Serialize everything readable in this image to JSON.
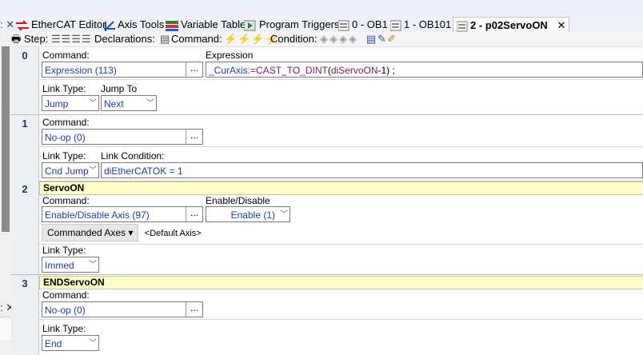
{
  "tabs": [
    {
      "label": "EtherCAT Editor",
      "icon": "ethercat-icon"
    },
    {
      "label": "Axis Tools",
      "icon": "axis-tools-icon"
    },
    {
      "label": "Variable Table",
      "icon": "variable-table-icon"
    },
    {
      "label": "Program Triggers",
      "icon": "program-triggers-icon"
    },
    {
      "label": "0 - OB1",
      "icon": "program-block-icon"
    },
    {
      "label": "1 - OB101",
      "icon": "program-block-icon"
    },
    {
      "label": "2 - p02ServoON",
      "icon": "program-block-icon"
    }
  ],
  "tab_close": "✕",
  "toolbar": {
    "step_label": "Step:",
    "declarations_label": "Declarations:",
    "command_label": "Command:",
    "condition_label": "Condition:"
  },
  "labels": {
    "command": "Command:",
    "expression": "Expression",
    "link_type": "Link Type:",
    "jump_to": "Jump To",
    "link_condition": "Link Condition:",
    "enable_disable": "Enable/Disable",
    "dots": "..."
  },
  "steps": [
    {
      "number": "0",
      "command_value": "Expression (113)",
      "expression_parts": {
        "var1": "_CurAxis",
        "op1": ":=",
        "fn": "CAST_TO_DINT",
        "p1": "(",
        "var2": "diServoON",
        "rest": "-1) ;"
      },
      "link_type": "Jump",
      "jump_to": "Next"
    },
    {
      "number": "1",
      "command_value": "No-op (0)",
      "link_type": "Cnd Jump",
      "link_condition": "diEtherCATOK = 1"
    },
    {
      "number": "2",
      "header": "ServoON",
      "command_value": "Enable/Disable Axis (97)",
      "enable_value": "Enable (1)",
      "commanded_axes_button": "Commanded Axes",
      "default_axis": "<Default Axis>",
      "link_type": "Immed"
    },
    {
      "number": "3",
      "header": "ENDServoON",
      "command_value": "No-op (0)",
      "link_type": "End"
    }
  ]
}
